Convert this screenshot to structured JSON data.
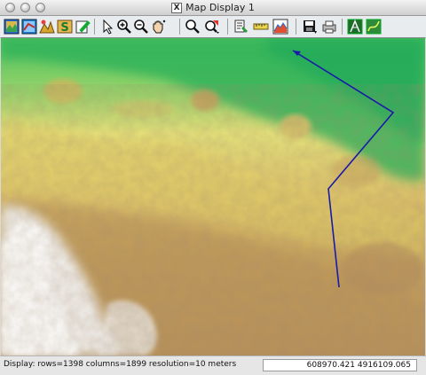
{
  "window": {
    "title": "Map Display 1",
    "x_icon_label": "X"
  },
  "toolbar": {
    "buttons": [
      {
        "name": "display-raster-icon"
      },
      {
        "name": "display-vector-icon"
      },
      {
        "name": "display-3d-icon"
      },
      {
        "name": "overlay-icon"
      },
      {
        "name": "edit-icon"
      },
      {
        "name": "pointer-icon"
      },
      {
        "name": "zoom-in-icon"
      },
      {
        "name": "zoom-out-icon"
      },
      {
        "name": "pan-icon"
      },
      {
        "name": "zoom-extent-icon"
      },
      {
        "name": "zoom-options-icon"
      },
      {
        "name": "query-icon"
      },
      {
        "name": "measure-icon"
      },
      {
        "name": "profile-icon"
      },
      {
        "name": "save-icon"
      },
      {
        "name": "print-icon"
      },
      {
        "name": "decorations-icon"
      },
      {
        "name": "analysis-icon"
      }
    ]
  },
  "status": {
    "text": "Display: rows=1398 columns=1899  resolution=10 meters",
    "coordinates": "608970.421 4916109.065"
  },
  "colors": {
    "route_line": "#1a1aa8",
    "low_elevation": "#2fa85a",
    "mid_elevation": "#e3d36a",
    "high_elevation": "#c89a4e",
    "peak_elevation": "#f2f2f2"
  }
}
